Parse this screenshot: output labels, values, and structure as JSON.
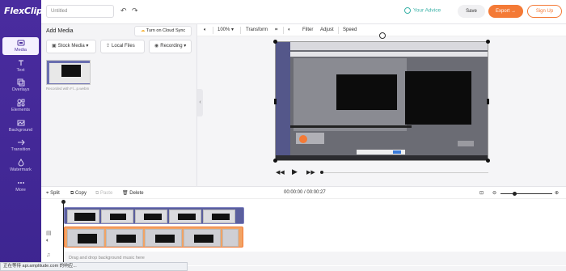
{
  "app": {
    "logo": "FlexClip",
    "project_title_placeholder": "Untitled"
  },
  "sidebar": {
    "items": [
      {
        "label": "Media",
        "icon": "media-icon",
        "active": true
      },
      {
        "label": "Text",
        "icon": "text-icon"
      },
      {
        "label": "Overlays",
        "icon": "overlays-icon"
      },
      {
        "label": "Elements",
        "icon": "elements-icon"
      },
      {
        "label": "Background",
        "icon": "background-icon"
      },
      {
        "label": "Transition",
        "icon": "transition-icon"
      },
      {
        "label": "Watermark",
        "icon": "watermark-icon"
      },
      {
        "label": "More",
        "icon": "more-icon"
      }
    ]
  },
  "topbar": {
    "advice_label": "Your Advice",
    "save_label": "Save",
    "export_label": "Export →",
    "signup_label": "Sign Up"
  },
  "media_panel": {
    "title": "Add Media",
    "cloud_sync_label": "Turn on Cloud Sync",
    "sources": [
      "Stock Media",
      "Local Files",
      "Recording"
    ],
    "thumbnail_caption": "Recorded with Fl...p.webm"
  },
  "canvas_toolbar": {
    "zoom": "100%",
    "transform_label": "Transform",
    "filter_label": "Filter",
    "adjust_label": "Adjust",
    "speed_label": "Speed"
  },
  "timeline_toolbar": {
    "split_label": "Split",
    "copy_label": "Copy",
    "paste_label": "Paste",
    "delete_label": "Delete",
    "current_time": "00:00:00",
    "total_time": "00:00:27",
    "zoom_level": 0.25
  },
  "timeline": {
    "music_placeholder": "Drag and drop background music here"
  },
  "status_bar": {
    "text": "正在等待 api.amplitude.com 的响应..."
  },
  "colors": {
    "sidebar": "#4b2f9e",
    "accent_orange": "#f47a36",
    "advice_teal": "#3bb2a8"
  }
}
